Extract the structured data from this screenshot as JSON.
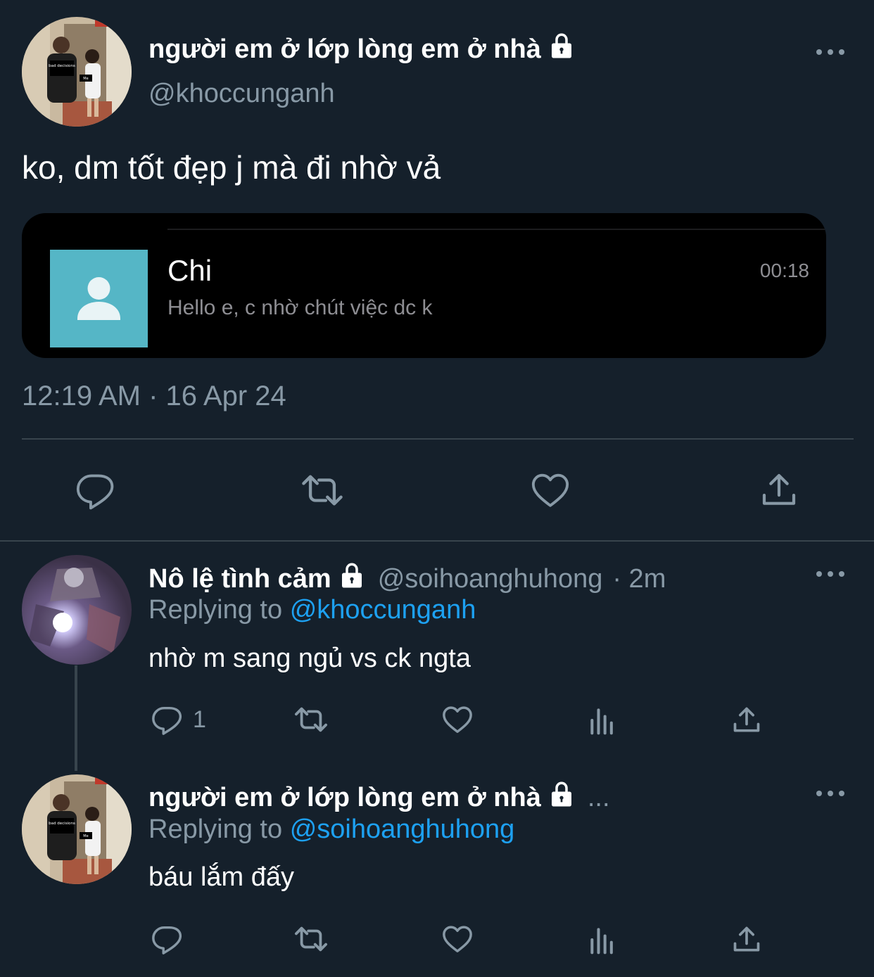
{
  "main_tweet": {
    "author_name": "người em ở lớp lòng em ở nhà",
    "handle": "@khoccunganh",
    "avatar_icon": "avatar-photo-icon",
    "avatar_labels": [
      "bad decisions",
      "Me"
    ],
    "text": "ko, dm tốt đẹp j mà đi nhờ vả",
    "attachment": {
      "contact_name": "Chi",
      "message": "Hello e, c nhờ chút việc dc k",
      "time": "00:18"
    },
    "timestamp": "12:19 AM · 16 Apr 24",
    "actions": [
      "reply-icon",
      "retweet-icon",
      "like-icon",
      "share-icon"
    ]
  },
  "replies": [
    {
      "author_name": "Nô lệ tình cảm",
      "handle": "@soihoanghuhong",
      "time": "· 2m",
      "replying_prefix": "Replying to",
      "replying_to": "@khoccunganh",
      "text": "nhờ m sang ngủ vs ck ngta",
      "reply_count": "1"
    },
    {
      "author_name": "người em ở lớp lòng em ở nhà",
      "handle_truncated": "...",
      "replying_prefix": "Replying to",
      "replying_to": "@soihoanghuhong",
      "text": "báu lắm đấy",
      "avatar_labels": [
        "bad decisions",
        "Me"
      ]
    }
  ],
  "colors": {
    "background": "#15202b",
    "secondary_text": "#8899a6",
    "link": "#1da1f2",
    "divider": "#38444d",
    "contact_avatar": "#55b6c6"
  }
}
